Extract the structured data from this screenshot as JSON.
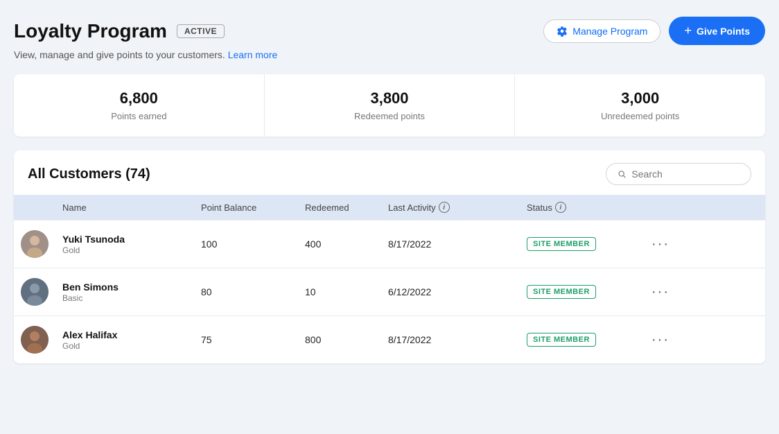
{
  "header": {
    "title": "Loyalty Program",
    "badge": "ACTIVE",
    "subtitle": "View, manage and give points to your customers.",
    "learn_more": "Learn more",
    "manage_btn": "Manage Program",
    "give_points_btn": "Give Points"
  },
  "stats": [
    {
      "value": "6,800",
      "label": "Points earned"
    },
    {
      "value": "3,800",
      "label": "Redeemed points"
    },
    {
      "value": "3,000",
      "label": "Unredeemed points"
    }
  ],
  "customers": {
    "title": "All Customers (74)",
    "search_placeholder": "Search",
    "table_headers": {
      "name": "Name",
      "point_balance": "Point Balance",
      "redeemed": "Redeemed",
      "last_activity": "Last Activity",
      "status": "Status"
    },
    "rows": [
      {
        "name": "Yuki Tsunoda",
        "tier": "Gold",
        "point_balance": "100",
        "redeemed": "400",
        "last_activity": "8/17/2022",
        "status": "SITE MEMBER",
        "avatar_class": "avatar-yuki"
      },
      {
        "name": "Ben Simons",
        "tier": "Basic",
        "point_balance": "80",
        "redeemed": "10",
        "last_activity": "6/12/2022",
        "status": "SITE MEMBER",
        "avatar_class": "avatar-ben"
      },
      {
        "name": "Alex Halifax",
        "tier": "Gold",
        "point_balance": "75",
        "redeemed": "800",
        "last_activity": "8/17/2022",
        "status": "SITE MEMBER",
        "avatar_class": "avatar-alex"
      }
    ]
  }
}
